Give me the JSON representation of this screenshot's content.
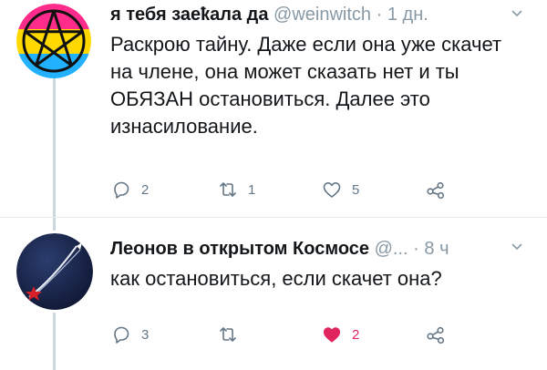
{
  "tweets": [
    {
      "display_name": "я тебя заеҟала да",
      "handle": "@weinwitch",
      "separator": "·",
      "time": "1 дн.",
      "text": "Раскрою тайну. Даже если она уже скачет на члене, она может сказать нет и ты ОБЯЗАН остановиться. Далее это изнасилование.",
      "replies": "2",
      "retweets": "1",
      "likes": "5",
      "liked": false,
      "avatar_icon": "pansexual-pentagram-avatar"
    },
    {
      "display_name": "Леонов в открытом Космосе",
      "handle": "@...",
      "separator": "·",
      "time": "8 ч",
      "text": "как остановиться, если скачет она?",
      "replies": "3",
      "retweets": "",
      "likes": "2",
      "liked": true,
      "avatar_icon": "space-rocket-avatar"
    }
  ],
  "colors": {
    "muted": "#657786",
    "like_red": "#e0245e",
    "thread_line": "#ccd6dd"
  }
}
